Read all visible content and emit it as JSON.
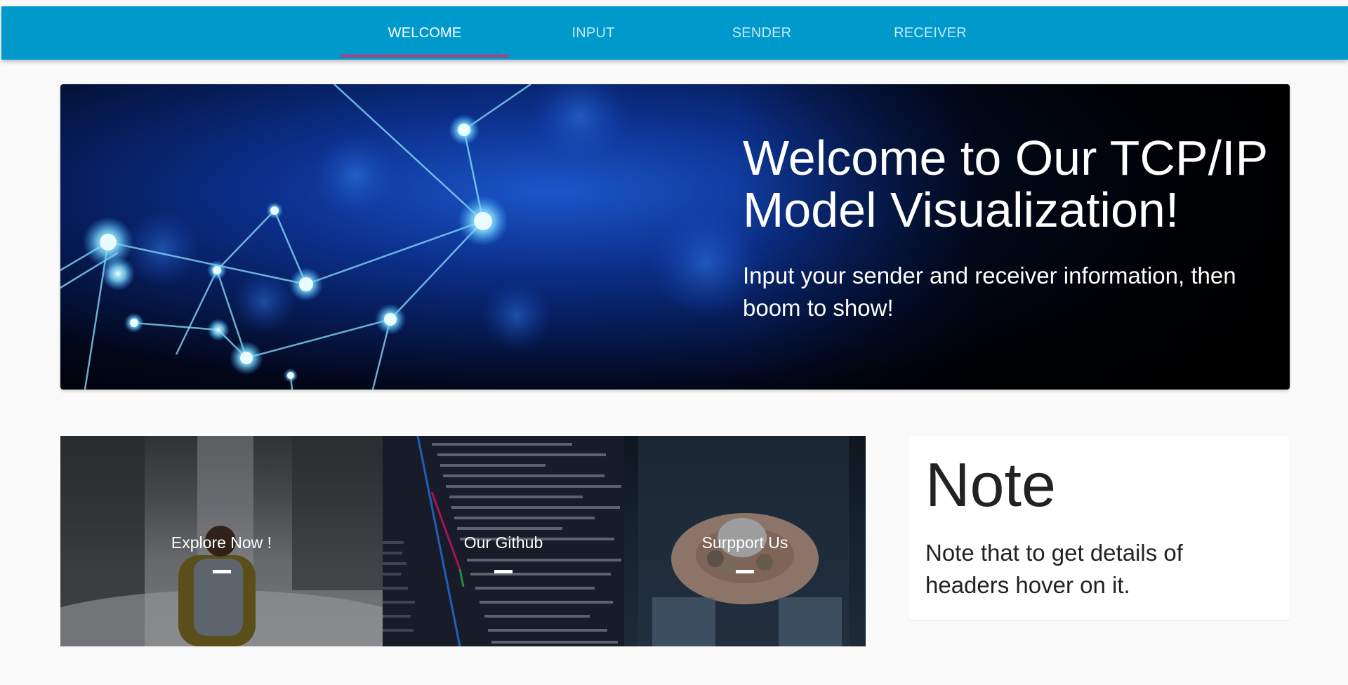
{
  "nav": {
    "tabs": [
      {
        "label": "WELCOME",
        "active": true
      },
      {
        "label": "INPUT",
        "active": false
      },
      {
        "label": "SENDER",
        "active": false
      },
      {
        "label": "RECEIVER",
        "active": false
      }
    ],
    "bar_color": "#0099cc",
    "indicator_color": "#e8266e"
  },
  "hero": {
    "title": "Welcome to Our TCP/IP Model Visualization!",
    "subtitle": "Input your sender and receiver information, then boom to show!"
  },
  "tiles": [
    {
      "label": "Explore Now !",
      "icon": "dash"
    },
    {
      "label": "Our Github",
      "icon": "dash"
    },
    {
      "label": "Surpport Us",
      "icon": "dash"
    }
  ],
  "note": {
    "title": "Note",
    "body": "Note that to get details of headers hover on it."
  }
}
